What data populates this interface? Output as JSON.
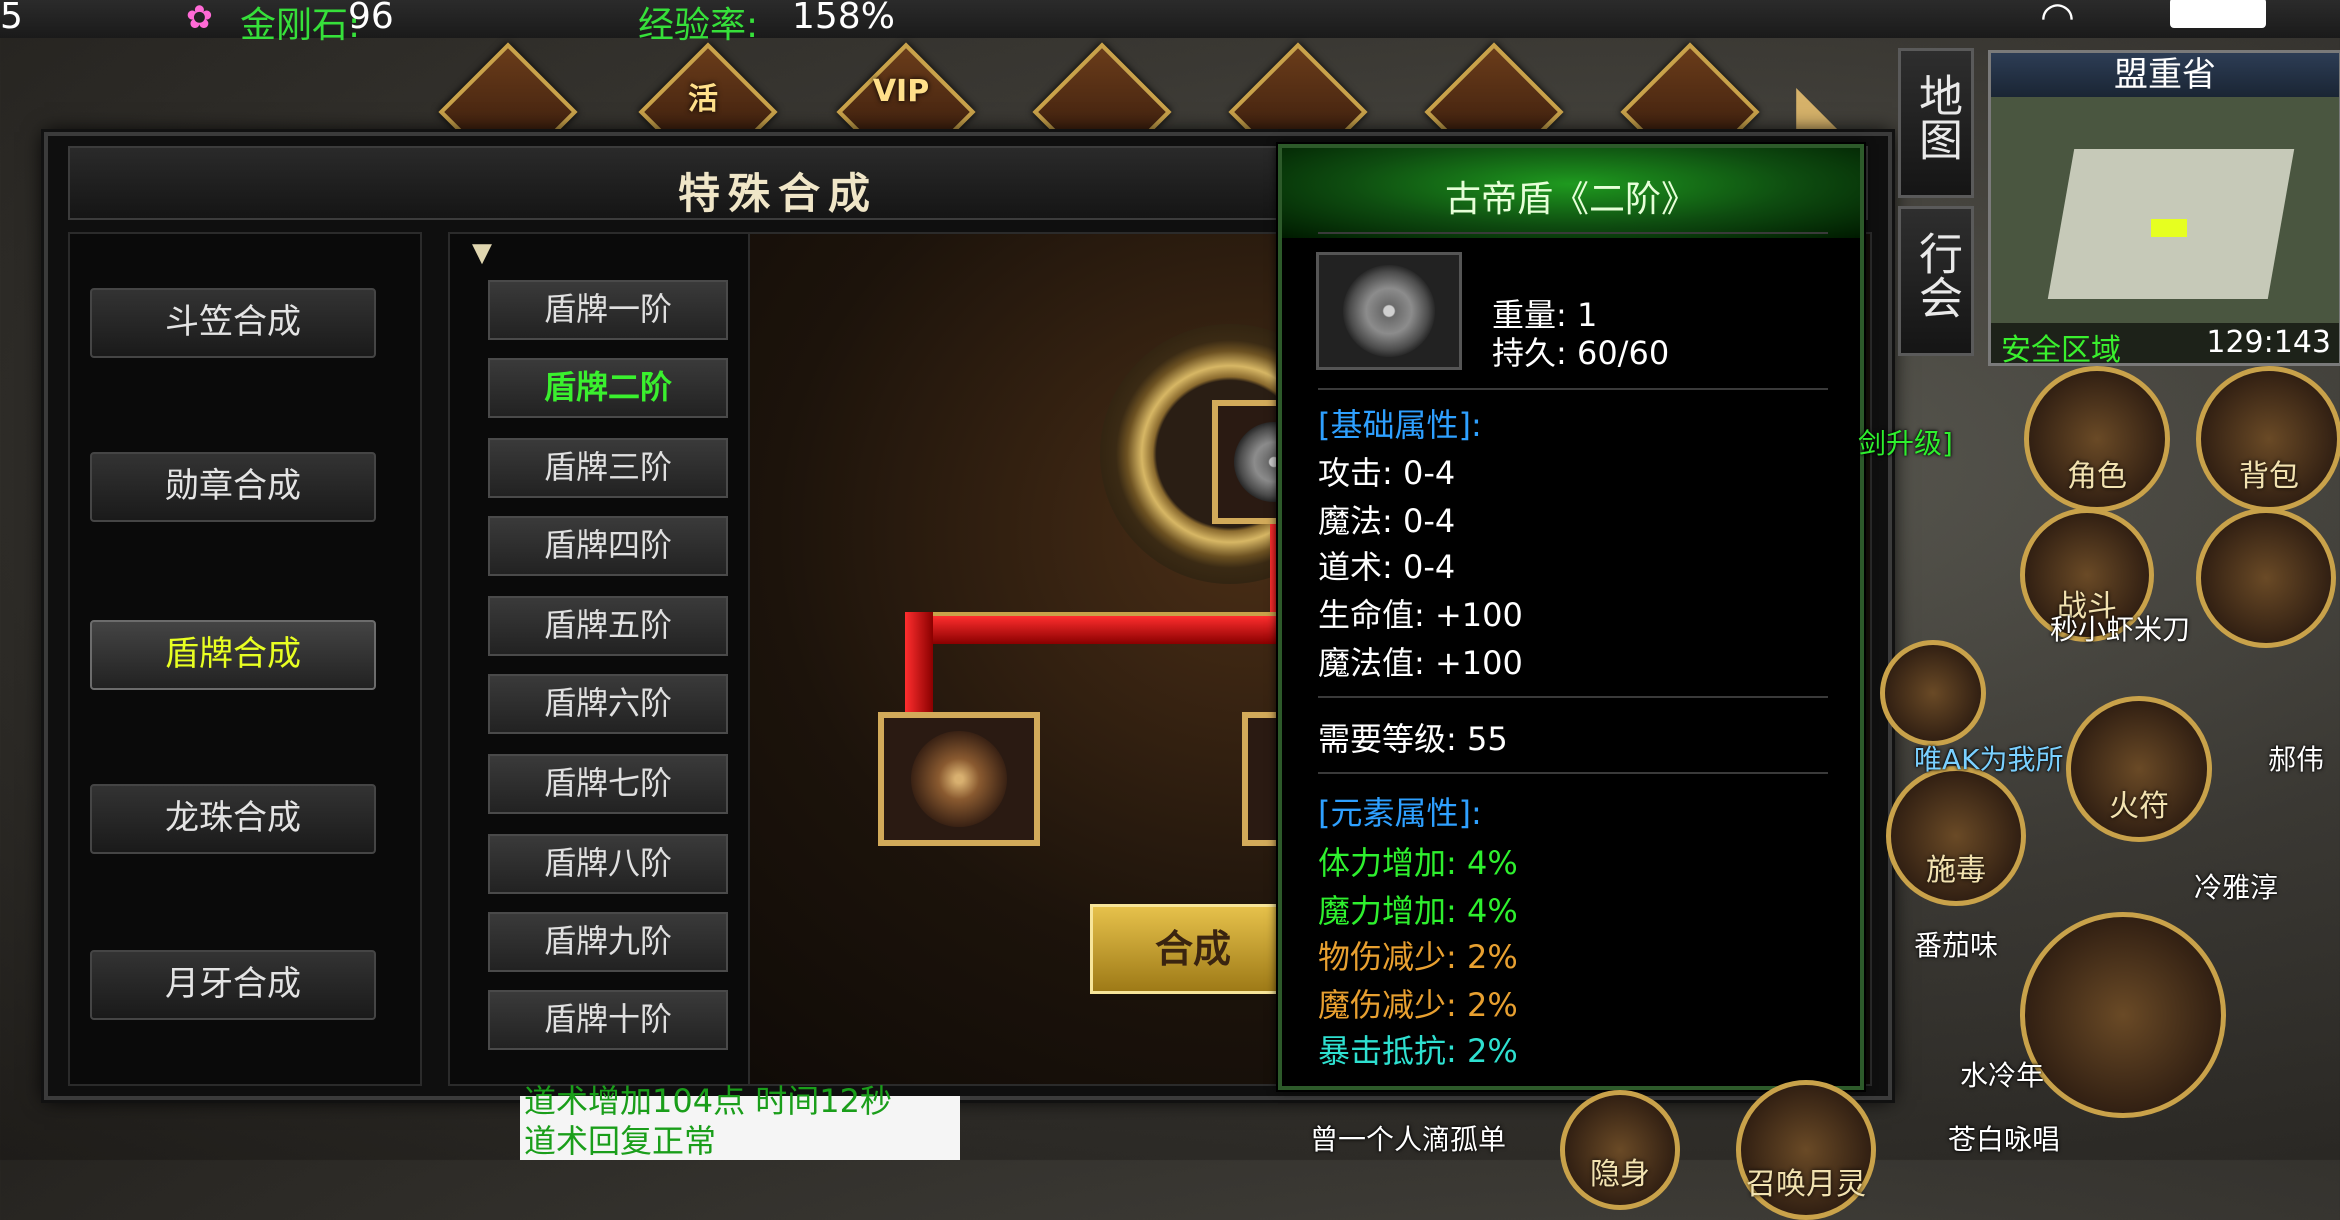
{
  "status_bar": {
    "left_fragment": "5",
    "diamond_label": "金刚石:",
    "diamond_value": "96",
    "exp_label": "经验率:",
    "exp_value": "158%"
  },
  "top_icons": [
    {
      "name": "quest-icon",
      "label": ""
    },
    {
      "name": "activity-icon",
      "label": "活"
    },
    {
      "name": "vip-icon",
      "label": "VIP"
    },
    {
      "name": "beauty-icon",
      "label": ""
    },
    {
      "name": "fortune-icon",
      "label": ""
    },
    {
      "name": "palace-icon",
      "label": ""
    },
    {
      "name": "gift-icon",
      "label": ""
    }
  ],
  "panel": {
    "title": "特殊合成",
    "categories": [
      {
        "label": "斗笠合成",
        "active": false
      },
      {
        "label": "勋章合成",
        "active": false
      },
      {
        "label": "盾牌合成",
        "active": true
      },
      {
        "label": "龙珠合成",
        "active": false
      },
      {
        "label": "月牙合成",
        "active": false
      }
    ],
    "tiers": [
      {
        "label": "盾牌一阶",
        "active": false
      },
      {
        "label": "盾牌二阶",
        "active": true
      },
      {
        "label": "盾牌三阶",
        "active": false
      },
      {
        "label": "盾牌四阶",
        "active": false
      },
      {
        "label": "盾牌五阶",
        "active": false
      },
      {
        "label": "盾牌六阶",
        "active": false
      },
      {
        "label": "盾牌七阶",
        "active": false
      },
      {
        "label": "盾牌八阶",
        "active": false
      },
      {
        "label": "盾牌九阶",
        "active": false
      },
      {
        "label": "盾牌十阶",
        "active": false
      }
    ],
    "craft_button": "合成"
  },
  "tooltip": {
    "title": "古帝盾《二阶》",
    "weight": "重量: 1",
    "durability": "持久: 60/60",
    "base_header": "[基础属性]:",
    "base_stats": [
      "攻击: 0-4",
      "魔法: 0-4",
      "道术: 0-4",
      "生命值: +100",
      "魔法值: +100"
    ],
    "level_req": "需要等级: 55",
    "element_header": "[元素属性]:",
    "element_stats": [
      {
        "text": "体力增加: 4%",
        "color": "#2ef02e"
      },
      {
        "text": "魔力增加: 4%",
        "color": "#2ef02e"
      },
      {
        "text": "物伤减少: 2%",
        "color": "#e8a030"
      },
      {
        "text": "魔伤减少: 2%",
        "color": "#e8a030"
      },
      {
        "text": "暴击抵抗: 2%",
        "color": "#2ee0d0"
      }
    ]
  },
  "side": {
    "map_btn": "地图",
    "guild_btn": "行会",
    "map_name": "盟重省",
    "zone": "安全区域",
    "coords": "129:143"
  },
  "round_buttons": {
    "character": "角色",
    "bag": "背包",
    "battle": "战斗",
    "craft": "",
    "skill1": "施毒",
    "fire": "火符",
    "stealth": "隐身",
    "summon": "召唤月灵"
  },
  "world_labels": {
    "upgrade": "剑升级]",
    "player1": "秒小虾米刀",
    "player2": "唯AK为我所",
    "player3": "郝伟",
    "player4": "冷雅淳",
    "player5": "番茄味",
    "player6": "苍白咏唱",
    "player7": "曾一个人滴孤单",
    "player8": "水冷年"
  },
  "chat": {
    "line1": "道术增加104点 时间12秒",
    "line2": "道术回复正常"
  },
  "colors": {
    "active_category": "#e8ff22",
    "active_tier": "#3af02e",
    "tooltip_header": "#2ef02e",
    "attr_header": "#2ea0ff"
  }
}
